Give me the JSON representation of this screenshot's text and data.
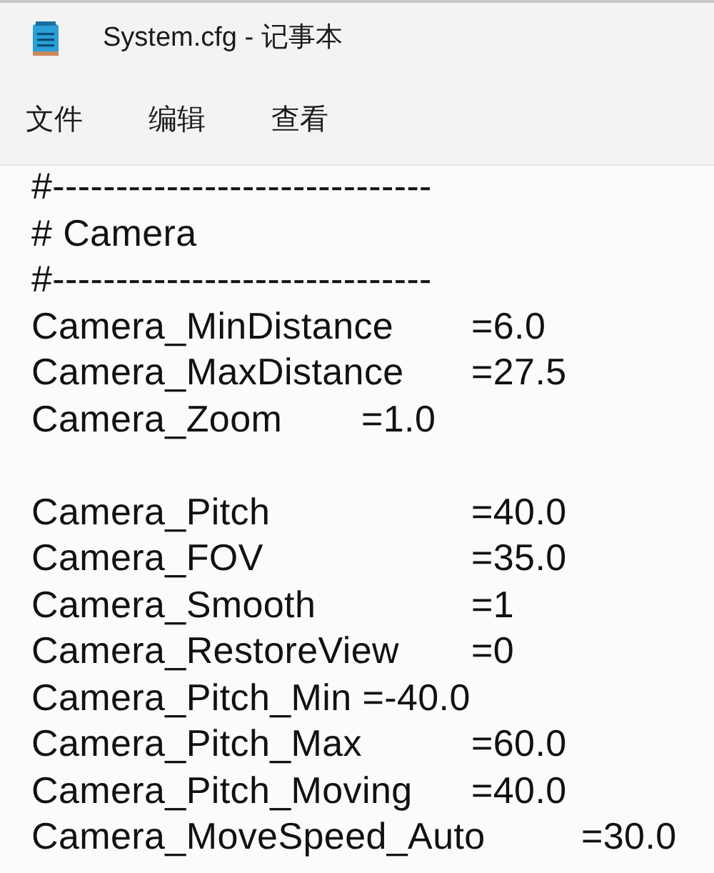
{
  "window": {
    "title": "System.cfg - 记事本"
  },
  "menu": [
    {
      "label": "文件"
    },
    {
      "label": "编辑"
    },
    {
      "label": "查看"
    }
  ],
  "lines": [
    {
      "kind": "text",
      "text": "#------------------------------"
    },
    {
      "kind": "text",
      "text": "# Camera"
    },
    {
      "kind": "text",
      "text": "#------------------------------"
    },
    {
      "kind": "text",
      "text": "Camera_MinDistance\t=6.0"
    },
    {
      "kind": "text",
      "text": "Camera_MaxDistance\t=27.5"
    },
    {
      "kind": "text",
      "text": "Camera_Zoom\t=1.0"
    },
    {
      "kind": "blank"
    },
    {
      "kind": "text",
      "text": "Camera_Pitch\t\t=40.0"
    },
    {
      "kind": "text",
      "text": "Camera_FOV\t\t=35.0"
    },
    {
      "kind": "text",
      "text": "Camera_Smooth\t\t=1"
    },
    {
      "kind": "text",
      "text": "Camera_RestoreView\t=0"
    },
    {
      "kind": "text",
      "text": "Camera_Pitch_Min =-40.0"
    },
    {
      "kind": "text",
      "text": "Camera_Pitch_Max\t=60.0"
    },
    {
      "kind": "text",
      "text": "Camera_Pitch_Moving\t=40.0"
    },
    {
      "kind": "text",
      "text": "Camera_MoveSpeed_Auto\t=30.0"
    }
  ]
}
